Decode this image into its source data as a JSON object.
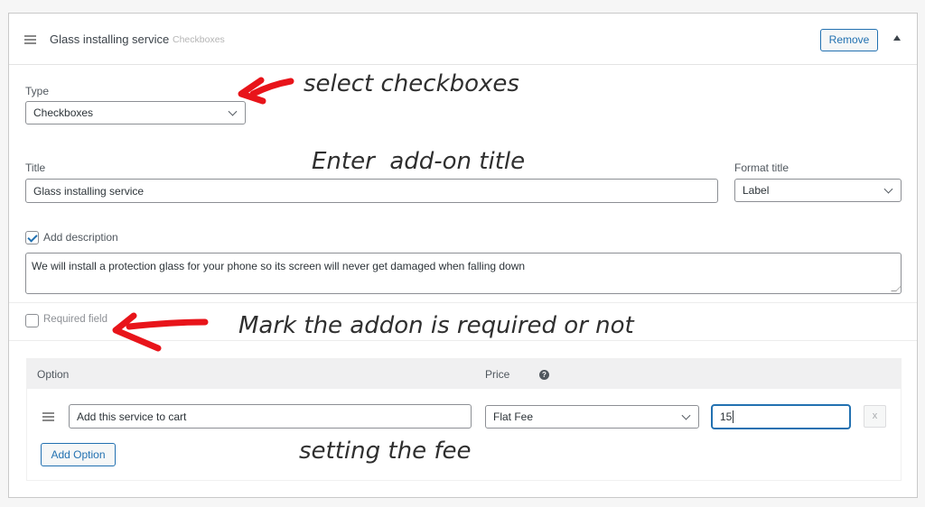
{
  "header": {
    "title": "Glass installing service",
    "type_badge": "Checkboxes",
    "remove_label": "Remove"
  },
  "form": {
    "type_label": "Type",
    "type_value": "Checkboxes",
    "title_label": "Title",
    "title_value": "Glass installing service",
    "format_title_label": "Format title",
    "format_title_value": "Label",
    "add_description_label": "Add description",
    "add_description_checked": true,
    "description_value": "We will install a protection glass for your phone so its screen will never get damaged when falling down",
    "required_label": "Required field",
    "required_checked": false
  },
  "options": {
    "option_header": "Option",
    "price_header": "Price",
    "help_glyph": "?",
    "rows": [
      {
        "label": "Add this service to cart",
        "price_type": "Flat Fee",
        "price": "15",
        "remove_glyph": "x"
      }
    ],
    "add_option_label": "Add Option"
  },
  "annotations": {
    "type_note": "select checkboxes",
    "title_note": "Enter  add-on title",
    "required_note": "Mark the addon is required or not",
    "fee_note": "setting the fee",
    "arrow_color": "#e8141a"
  }
}
